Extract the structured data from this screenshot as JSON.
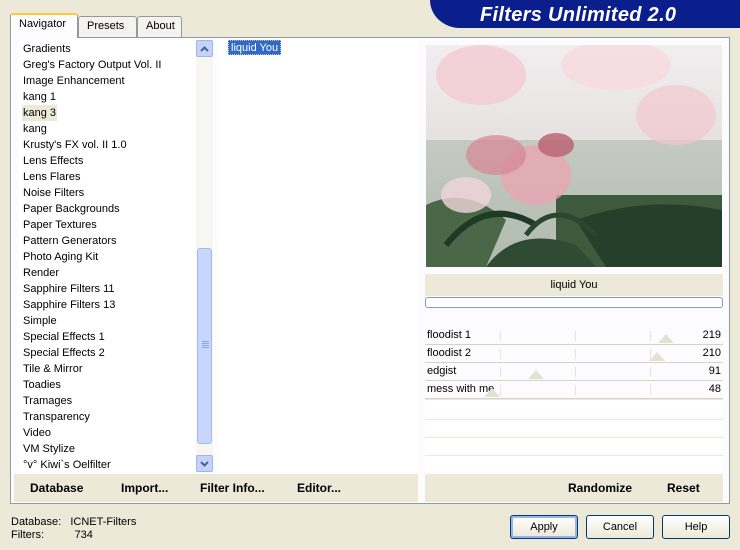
{
  "tabs": [
    {
      "label": "Navigator",
      "active": true
    },
    {
      "label": "Presets",
      "active": false
    },
    {
      "label": "About",
      "active": false
    }
  ],
  "banner_title": "Filters Unlimited 2.0",
  "categories": [
    "Gradients",
    "Greg's Factory Output Vol. II",
    "Image Enhancement",
    "kang 1",
    "kang 3",
    "kang",
    "Krusty's FX vol. II 1.0",
    "Lens Effects",
    "Lens Flares",
    "Noise Filters",
    "Paper Backgrounds",
    "Paper Textures",
    "Pattern Generators",
    "Photo Aging Kit",
    "Render",
    "Sapphire Filters 11",
    "Sapphire Filters 13",
    "Simple",
    "Special Effects 1",
    "Special Effects 2",
    "Tile & Mirror",
    "Toadies",
    "Tramages",
    "Transparency",
    "Video",
    "VM Stylize",
    "°v° Kiwi`s Oelfilter"
  ],
  "selected_category": "kang 3",
  "filters": [
    "liquid You"
  ],
  "selected_filter": "liquid You",
  "filter_name_display": "liquid You",
  "sliders": [
    {
      "label": "floodist 1",
      "value": "219",
      "level": 219,
      "max": 255
    },
    {
      "label": "floodist 2",
      "value": "210",
      "level": 210,
      "max": 255
    },
    {
      "label": "edgist",
      "value": "91",
      "level": 91,
      "max": 255
    },
    {
      "label": "mess with me",
      "value": "48",
      "level": 48,
      "max": 255
    }
  ],
  "toolbar": {
    "database": "Database",
    "import": "Import...",
    "filter_info": "Filter Info...",
    "editor": "Editor...",
    "randomize": "Randomize",
    "reset": "Reset"
  },
  "status": {
    "database_label": "Database:",
    "database_value": "ICNET-Filters",
    "filters_label": "Filters:",
    "filters_value": "734"
  },
  "buttons": {
    "apply": "Apply",
    "cancel": "Cancel",
    "help": "Help"
  },
  "icons": {
    "scroll_up": "chevron-up-icon",
    "scroll_down": "chevron-down-icon"
  },
  "colors": {
    "banner": "#0a1e8c",
    "selection": "#316ac5",
    "scroll": "#c3d3fd"
  }
}
